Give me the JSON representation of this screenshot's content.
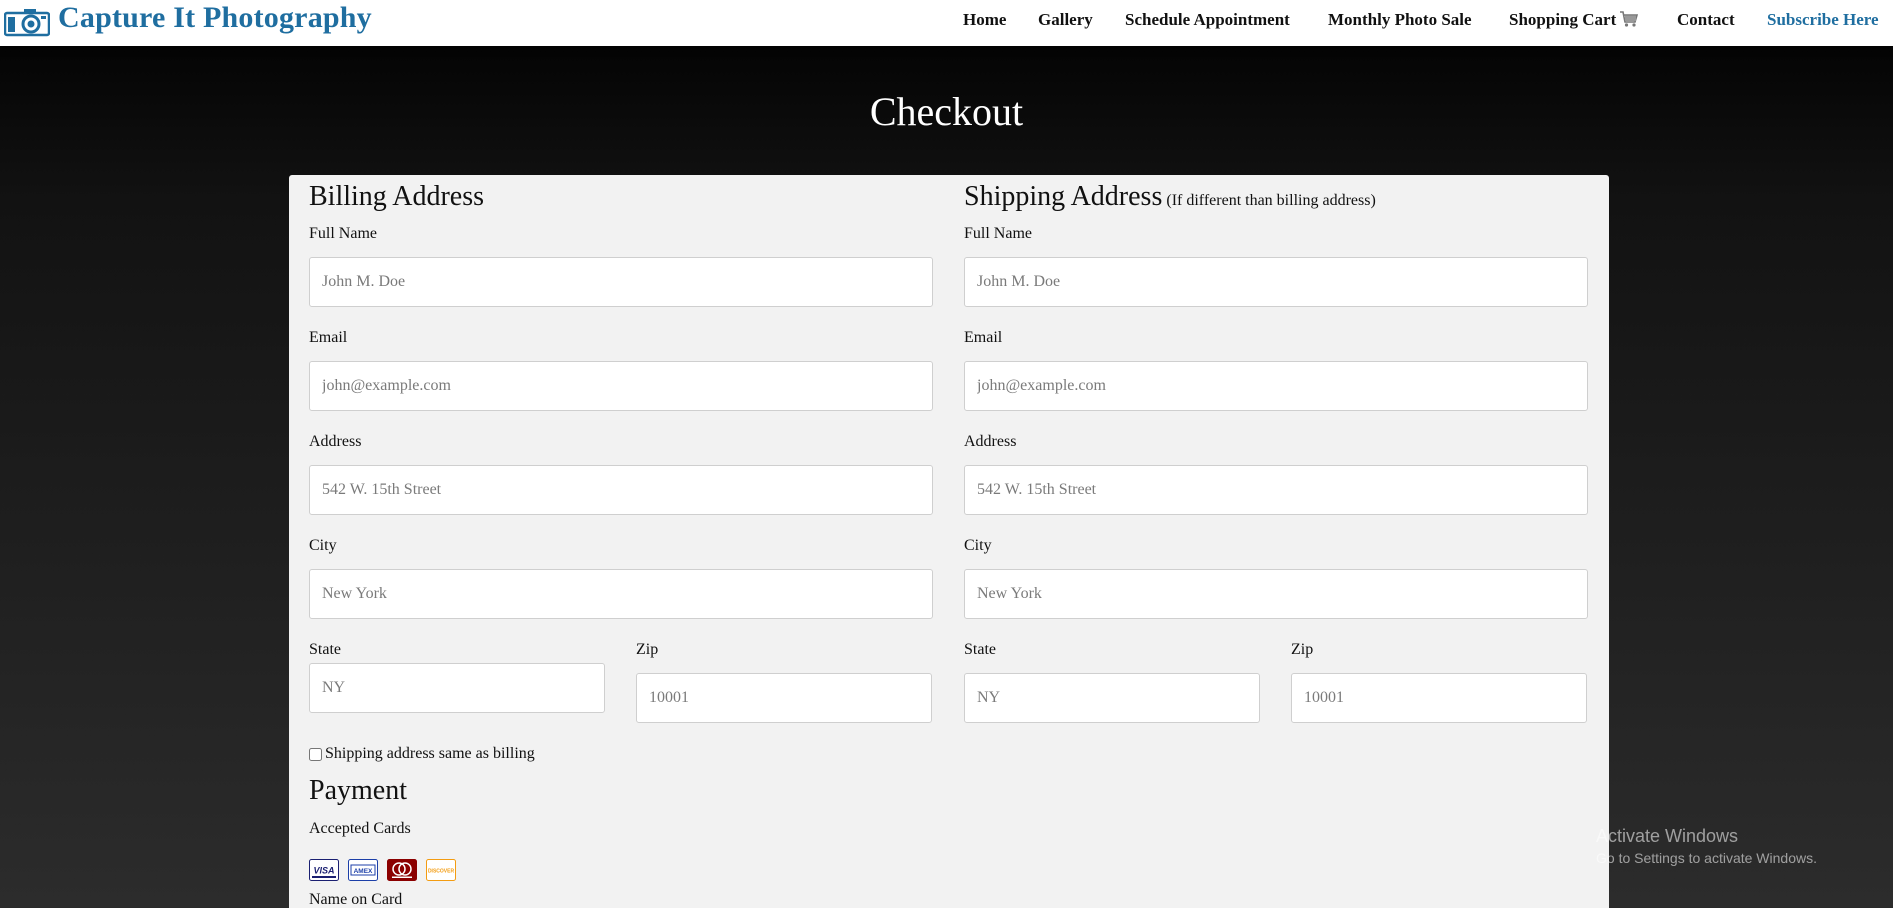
{
  "navbar": {
    "brand_name": "Capture It Photography",
    "links": {
      "home": "Home",
      "gallery": "Gallery",
      "schedule": "Schedule Appointment",
      "sale": "Monthly Photo Sale",
      "cart": "Shopping Cart",
      "contact": "Contact",
      "subscribe": "Subscribe Here"
    },
    "brand_color": "#1f6ea0"
  },
  "page": {
    "title": "Checkout"
  },
  "billing": {
    "heading": "Billing Address",
    "full_name_label": "Full Name",
    "full_name_placeholder": "John M. Doe",
    "email_label": "Email",
    "email_placeholder": "john@example.com",
    "address_label": "Address",
    "address_placeholder": "542 W. 15th Street",
    "city_label": "City",
    "city_placeholder": "New York",
    "state_label": "State",
    "state_placeholder": "NY",
    "zip_label": "Zip",
    "zip_placeholder": "10001"
  },
  "shipping": {
    "heading": "Shipping Address",
    "note": "(If different than billing address)",
    "full_name_label": "Full Name",
    "full_name_placeholder": "John M. Doe",
    "email_label": "Email",
    "email_placeholder": "john@example.com",
    "address_label": "Address",
    "address_placeholder": "542 W. 15th Street",
    "city_label": "City",
    "city_placeholder": "New York",
    "state_label": "State",
    "state_placeholder": "NY",
    "zip_label": "Zip",
    "zip_placeholder": "10001"
  },
  "same_as_billing": {
    "label": "Shipping address same as billing",
    "checked": false
  },
  "payment": {
    "heading": "Payment",
    "accepted_cards_label": "Accepted Cards",
    "cards": [
      {
        "name": "VISA",
        "color": "#1a1f71",
        "icon": "visa-icon"
      },
      {
        "name": "AMEX",
        "color": "#1c3fa8",
        "icon": "amex-icon"
      },
      {
        "name": "MasterCard",
        "color": "#8b0000",
        "icon": "mastercard-icon"
      },
      {
        "name": "DISCOVER",
        "color": "#f39c12",
        "icon": "discover-icon"
      }
    ],
    "name_on_card_label": "Name on Card"
  },
  "watermark": {
    "title": "Activate Windows",
    "subtitle": "Go to Settings to activate Windows."
  }
}
